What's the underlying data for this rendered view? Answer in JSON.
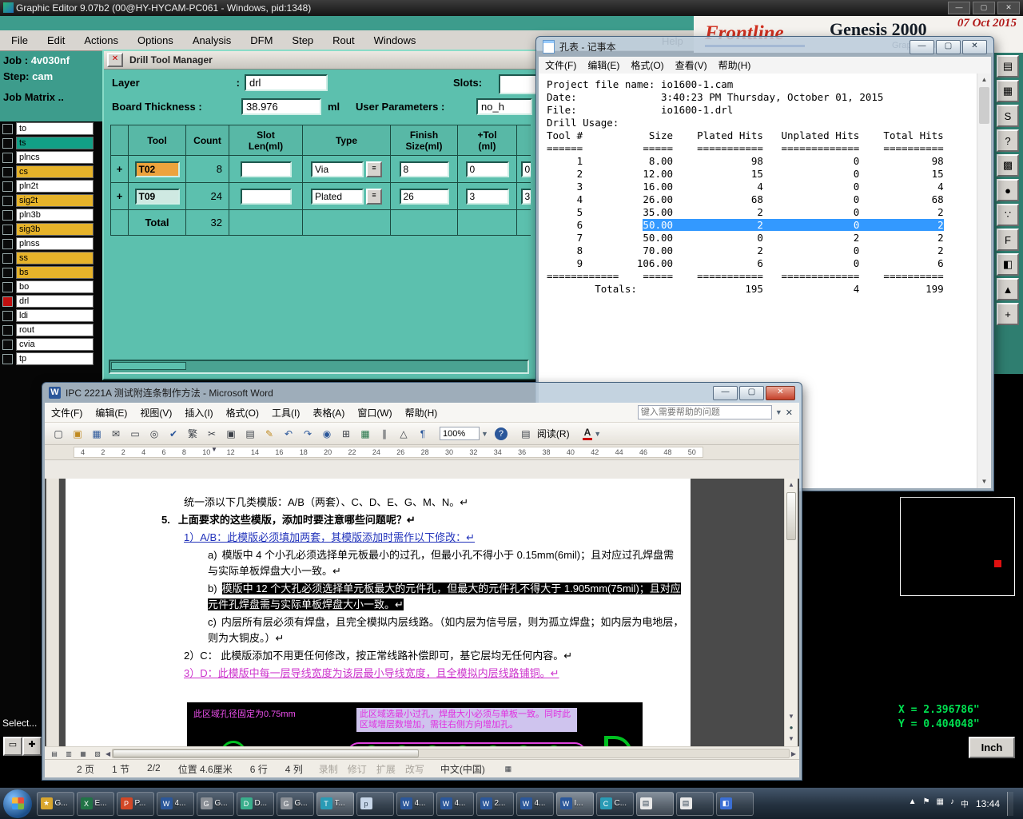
{
  "window": {
    "title": "Graphic Editor 9.07b2 (00@HY-HYCAM-PC061 - Windows, pid:1348)"
  },
  "menubar": {
    "items": [
      "File",
      "Edit",
      "Actions",
      "Options",
      "Analysis",
      "DFM",
      "Step",
      "Rout",
      "Windows"
    ],
    "help": "Help"
  },
  "brand": {
    "logo": "Frontline",
    "product": "Genesis 2000",
    "date": "07 Oct 2015",
    "subtitle": "Graphic Editor"
  },
  "job_panel": {
    "job_label": "Job :",
    "job_value": "4v030nf",
    "step_label": "Step:",
    "step_value": "cam",
    "matrix_label": "Job Matrix .."
  },
  "layer_panel": {
    "layers": [
      {
        "name": "to",
        "tone": "white"
      },
      {
        "name": "ts",
        "tone": "green"
      },
      {
        "name": "plncs",
        "tone": "white"
      },
      {
        "name": "cs",
        "tone": "yellow"
      },
      {
        "name": "pln2t",
        "tone": "white"
      },
      {
        "name": "sig2t",
        "tone": "yellow"
      },
      {
        "name": "pln3b",
        "tone": "white"
      },
      {
        "name": "sig3b",
        "tone": "yellow"
      },
      {
        "name": "plnss",
        "tone": "white"
      },
      {
        "name": "ss",
        "tone": "yellow"
      },
      {
        "name": "bs",
        "tone": "yellow"
      },
      {
        "name": "bo",
        "tone": "white"
      },
      {
        "name": "drl",
        "tone": "white",
        "active": "true"
      },
      {
        "name": "ldi",
        "tone": "white"
      },
      {
        "name": "rout",
        "tone": "white"
      },
      {
        "name": "cvia",
        "tone": "white"
      },
      {
        "name": "tp",
        "tone": "white"
      }
    ],
    "select_label": "Select..."
  },
  "drill_manager": {
    "title": "Drill Tool Manager",
    "layer_label": "Layer",
    "layer_colon": ":",
    "layer_value": "drl",
    "slots_label": "Slots:",
    "thickness_label": "Board Thickness :",
    "thickness_value": "38.976",
    "thickness_unit": "ml",
    "user_params_label": "User Parameters :",
    "user_params_value": "no_h",
    "table": {
      "headers": [
        "Tool",
        "Count",
        "Slot\nLen(ml)",
        "Type",
        "Finish\nSize(ml)",
        "+Tol\n(ml)"
      ],
      "rows": [
        {
          "tool": "T02",
          "count": "8",
          "slot_len": "",
          "type": "Via",
          "finish": "8",
          "ptol": "0",
          "next": "0"
        },
        {
          "tool": "T09",
          "count": "24",
          "slot_len": "",
          "type": "Plated",
          "finish": "26",
          "ptol": "3",
          "next": "3"
        }
      ],
      "total_label": "Total",
      "total_count": "32"
    }
  },
  "notepad": {
    "title": "孔表 - 记事本",
    "menus": [
      "文件(F)",
      "编辑(E)",
      "格式(O)",
      "查看(V)",
      "帮助(H)"
    ],
    "lines_before": [
      "Project file name: io1600-1.cam",
      "Date:              3:40:23 PM Thursday, October 01, 2015",
      "File:              io1600-1.drl",
      "Drill Usage:",
      "Tool #           Size    Plated Hits   Unplated Hits    Total Hits",
      "======          =====    ===========   =============    ==========",
      "     1           8.00             98               0            98",
      "     2          12.00             15               0            15",
      "     3          16.00              4               0             4",
      "     4          26.00             68               0            68",
      "     5          35.00              2               0             2"
    ],
    "highlight_line": {
      "pre": "     6          ",
      "sel": "50.00              2               0             2"
    },
    "lines_after": [
      "     7          50.00              0               2             2",
      "     8          70.00              2               0             2",
      "     9         106.00              6               0             6",
      "============    =====    ===========   =============    ==========",
      "        Totals:                  195               4           199"
    ]
  },
  "word": {
    "title": "IPC 2221A 测试附连条制作方法 - Microsoft Word",
    "menus": [
      "文件(F)",
      "编辑(E)",
      "视图(V)",
      "插入(I)",
      "格式(O)",
      "工具(I)",
      "表格(A)",
      "窗口(W)",
      "帮助(H)"
    ],
    "help_placeholder": "键入需要帮助的问题",
    "toolbar": [
      {
        "name": "new-doc-icon",
        "glyph": "▢",
        "tone": "plain"
      },
      {
        "name": "open-folder-icon",
        "glyph": "▣",
        "tone": "gold"
      },
      {
        "name": "save-icon",
        "glyph": "▦",
        "tone": "blue"
      },
      {
        "name": "email-icon",
        "glyph": "✉",
        "tone": "plain"
      },
      {
        "name": "print-icon",
        "glyph": "▭",
        "tone": "plain"
      },
      {
        "name": "print-preview-icon",
        "glyph": "◎",
        "tone": "plain"
      },
      {
        "name": "spellcheck-icon",
        "glyph": "✔",
        "tone": "blue"
      },
      {
        "name": "chinese-convert-icon",
        "glyph": "繁",
        "tone": "plain"
      },
      {
        "name": "cut-icon",
        "glyph": "✂",
        "tone": "plain"
      },
      {
        "name": "copy-icon",
        "glyph": "▣",
        "tone": "plain"
      },
      {
        "name": "paste-icon",
        "glyph": "▤",
        "tone": "plain"
      },
      {
        "name": "format-painter-icon",
        "glyph": "✎",
        "tone": "gold"
      },
      {
        "name": "undo-icon",
        "glyph": "↶",
        "tone": "blue"
      },
      {
        "name": "redo-icon",
        "glyph": "↷",
        "tone": "blue"
      },
      {
        "name": "hyperlink-icon",
        "glyph": "◉",
        "tone": "blue"
      },
      {
        "name": "insert-table-icon",
        "glyph": "⊞",
        "tone": "plain"
      },
      {
        "name": "insert-excel-icon",
        "glyph": "▦",
        "tone": "green"
      },
      {
        "name": "columns-icon",
        "glyph": "∥",
        "tone": "plain"
      },
      {
        "name": "drawing-icon",
        "glyph": "△",
        "tone": "plain"
      },
      {
        "name": "show-marks-icon",
        "glyph": "¶",
        "tone": "blue"
      }
    ],
    "zoom": "100%",
    "reading_label": "阅读(R)",
    "font_color_label": "A",
    "ruler_numbers": [
      "4",
      "2",
      "2",
      "4",
      "6",
      "8",
      "10",
      "12",
      "14",
      "16",
      "18",
      "20",
      "22",
      "24",
      "26",
      "28",
      "30",
      "32",
      "34",
      "36",
      "38",
      "40",
      "42",
      "44",
      "46",
      "48",
      "50"
    ],
    "doc": {
      "intro": "统一添以下几类模版：A/B（两套）、C、D、E、G、M、N。↵",
      "item5_num": "5.",
      "item5_text": "上面要求的这些模版，添加时要注意哪些问题呢？↵",
      "sub1": "1）A/B：此模版必须填加两套，其模版添加时需作以下修改：↵",
      "a_label": "a)",
      "a_text": "模版中 4 个小孔必须选择单元板最小的过孔，但最小孔不得小于 0.15mm(6mil)；且对应过孔焊盘需与实际单板焊盘大小一致。↵",
      "b_label": "b)",
      "b_text": "模版中 12 个大孔必须选择单元板最大的元件孔，但最大的元件孔不得大于 1.905mm(75mil)；且对应元件孔焊盘需与实际单板焊盘大小一致。↵",
      "c_label": "c)",
      "c_text": "内层所有层必须有焊盘，且完全模拟内层线路。（如内层为信号层，则为孤立焊盘；如内层为电地层，则为大铜皮。）↵",
      "sub2": "2）C：  此模版添加不用更任何修改，按正常线路补偿即可，基它层均无任何内容。↵",
      "sub3": "3）D：此模版中每一层导线宽度为该层最小导线宽度，且全模拟内层线路铺铜。↵",
      "img_note1": "此区域孔径固定为0.75mm",
      "img_note2": "此区域选最小过孔，焊盘大小必须与单板一致。同时此区域增层数增加，需往右侧方向增加孔。"
    },
    "statusbar": {
      "items": [
        "2 页",
        "1 节",
        "2/2",
        "位置 4.6厘米",
        "6 行",
        "4 列"
      ],
      "modes": [
        "录制",
        "修订",
        "扩展",
        "改写"
      ],
      "lang": "中文(中国)"
    }
  },
  "coords": {
    "x_readout": "X = 2.396786\"",
    "y_readout": "Y = 0.404048\"",
    "unit_button": "Inch"
  },
  "right_toolbar": {
    "buttons": [
      {
        "name": "dock-panel-icon",
        "glyph": "▤"
      },
      {
        "name": "grid-icon",
        "glyph": "▦"
      },
      {
        "name": "script-icon",
        "glyph": "S"
      },
      {
        "name": "help-icon",
        "glyph": "?"
      },
      {
        "name": "matrix-icon",
        "glyph": "▩"
      },
      {
        "name": "filled-circle-icon",
        "glyph": "●"
      },
      {
        "name": "color-dots-icon",
        "glyph": "∵"
      },
      {
        "name": "flip-tool-icon",
        "glyph": "F"
      },
      {
        "name": "palette-icon",
        "glyph": "◧"
      },
      {
        "name": "warning-icon",
        "glyph": "▲"
      },
      {
        "name": "crosshair-icon",
        "glyph": "+"
      }
    ]
  },
  "taskbar": {
    "clock": "13:44",
    "buttons": [
      {
        "tone": "gold",
        "glyph": "★",
        "label": "G..."
      },
      {
        "tone": "green",
        "glyph": "X",
        "label": "E..."
      },
      {
        "tone": "orange",
        "glyph": "P",
        "label": "P..."
      },
      {
        "tone": "word",
        "glyph": "W",
        "label": "4..."
      },
      {
        "tone": "gray",
        "glyph": "G",
        "label": "G..."
      },
      {
        "tone": "mint",
        "glyph": "D",
        "label": "D..."
      },
      {
        "tone": "gray",
        "glyph": "G",
        "label": "G..."
      },
      {
        "tone": "cyan",
        "glyph": "T",
        "label": "T...",
        "active": "true"
      },
      {
        "tone": "paint",
        "glyph": "p",
        "label": ""
      },
      {
        "tone": "word",
        "glyph": "W",
        "label": "4..."
      },
      {
        "tone": "word",
        "glyph": "W",
        "label": "4..."
      },
      {
        "tone": "word",
        "glyph": "W",
        "label": "2..."
      },
      {
        "tone": "word",
        "glyph": "W",
        "label": "4..."
      },
      {
        "tone": "word",
        "glyph": "W",
        "label": "I...",
        "active": "true"
      },
      {
        "tone": "cyan",
        "glyph": "C",
        "label": "C..."
      },
      {
        "tone": "note",
        "glyph": "▤",
        "label": "",
        "active": "true"
      },
      {
        "tone": "note",
        "glyph": "▤",
        "label": ""
      },
      {
        "tone": "blue",
        "glyph": "◧",
        "label": ""
      }
    ],
    "tray": [
      {
        "name": "tray-expand-icon",
        "glyph": "▲"
      },
      {
        "name": "action-center-icon",
        "glyph": "⚑"
      },
      {
        "name": "network-icon",
        "glyph": "▦"
      },
      {
        "name": "volume-icon",
        "glyph": "♪"
      },
      {
        "name": "ime-indicator",
        "glyph": "中"
      }
    ]
  }
}
